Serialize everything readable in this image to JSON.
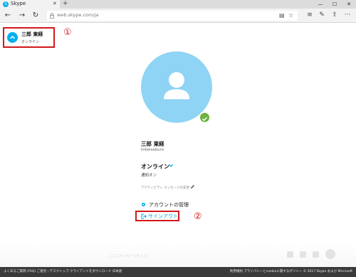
{
  "browser": {
    "tab_title": "Skype",
    "tab_close": "✕",
    "new_tab": "+",
    "window_controls": [
      "—",
      "☐",
      "✕"
    ],
    "url": "web.skype.com/ja",
    "nav_icons": [
      "back-arrow-icon",
      "forward-arrow-icon",
      "refresh-icon"
    ],
    "toolbar_icons": [
      "reading-view-icon",
      "favorite-star-icon",
      "hub-icon",
      "web-note-icon",
      "share-icon",
      "more-icon"
    ]
  },
  "profile": {
    "name": "三郎 東経",
    "status": "オンライン",
    "skype_id": "tokeisaburo",
    "presence": "オンライン",
    "notifications": "通知オン",
    "mood_placeholder": "アクティビティ メッセージの変更"
  },
  "menu": {
    "manage_account": "アカウントの管理",
    "sign_out": "サインアウト"
  },
  "markers": {
    "one": "①",
    "two": "②"
  },
  "composer": {
    "placeholder": "ここにメッセージを入力"
  },
  "footer": {
    "left": "よくあるご質問 (FAQ)   ご意見・デスクトップ クライアントをダウンロード   日本語",
    "right": "利用規約   プライバシーとcookieに関するポリシー   © 2017 Skype および Microsoft"
  },
  "colors": {
    "accent": "#00aff0",
    "avatar_bg": "#8fd4f4",
    "online": "#6cb33f",
    "highlight_red": "#d0191c",
    "link": "#00a3e0"
  }
}
